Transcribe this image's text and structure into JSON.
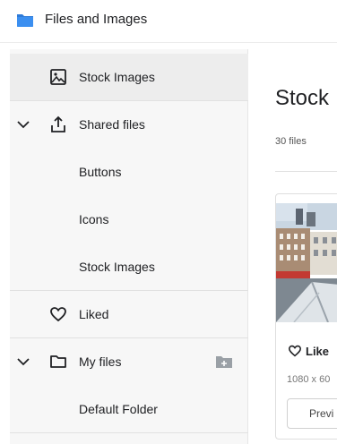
{
  "header": {
    "title": "Files and Images",
    "logo_icon": "folder-icon",
    "accent": "#2f7bd8"
  },
  "sidebar": {
    "items": [
      {
        "label": "Stock Images",
        "icon": "image-icon",
        "selected": true
      },
      {
        "label": "Shared files",
        "icon": "share-upload-icon",
        "expanded": true
      },
      {
        "label": "Buttons"
      },
      {
        "label": "Icons"
      },
      {
        "label": "Stock Images"
      },
      {
        "label": "Liked",
        "icon": "heart-icon"
      },
      {
        "label": "My files",
        "icon": "folder-outline-icon",
        "expanded": true,
        "action_icon": "add-folder-icon"
      },
      {
        "label": "Default Folder"
      }
    ]
  },
  "main": {
    "title": "Stock",
    "file_count": "30 files",
    "card": {
      "like_label": "Like",
      "dimensions": "1080 x 60",
      "preview_label": "Previ"
    }
  }
}
